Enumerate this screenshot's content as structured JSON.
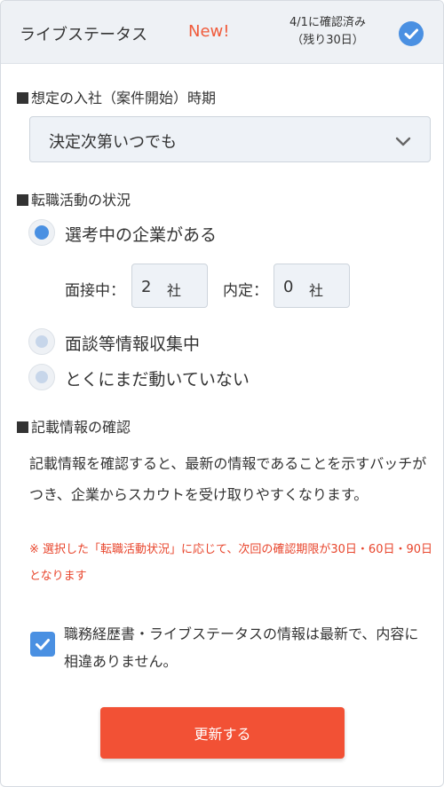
{
  "header": {
    "title": "ライブステータス",
    "badge_new": "New!",
    "status_line1": "4/1に確認済み",
    "status_line2": "（残り30日）",
    "check_icon": "check-circle-icon"
  },
  "join_period": {
    "title": "想定の入社（案件開始）時期",
    "selected": "決定次第いつでも",
    "chevron_icon": "chevron-down-icon"
  },
  "activity": {
    "title": "転職活動の状況",
    "options": [
      {
        "label": "選考中の企業がある",
        "selected": true
      },
      {
        "label": "面談等情報収集中",
        "selected": false
      },
      {
        "label": "とくにまだ動いていない",
        "selected": false
      }
    ],
    "interview_label": "面接中：",
    "interview_count": "2",
    "offer_label": "内定：",
    "offer_count": "0",
    "unit": "社"
  },
  "confirm": {
    "title": "記載情報の確認",
    "description": "記載情報を確認すると、最新の情報であることを示すバッチがつき、企業からスカウトを受け取りやすくなります。",
    "note": "※ 選択した「転職活動状況」に応じて、次回の確認期限が30日・60日・90日となります",
    "checkbox_label": "職務経歴書・ライブステータスの情報は最新で、内容に相違ありません。",
    "checkbox_checked": true
  },
  "submit_label": "更新する",
  "colors": {
    "accent_blue": "#4a90e2",
    "accent_red": "#f05a3a",
    "button_red": "#f25135",
    "header_bg": "#eef1f5"
  }
}
